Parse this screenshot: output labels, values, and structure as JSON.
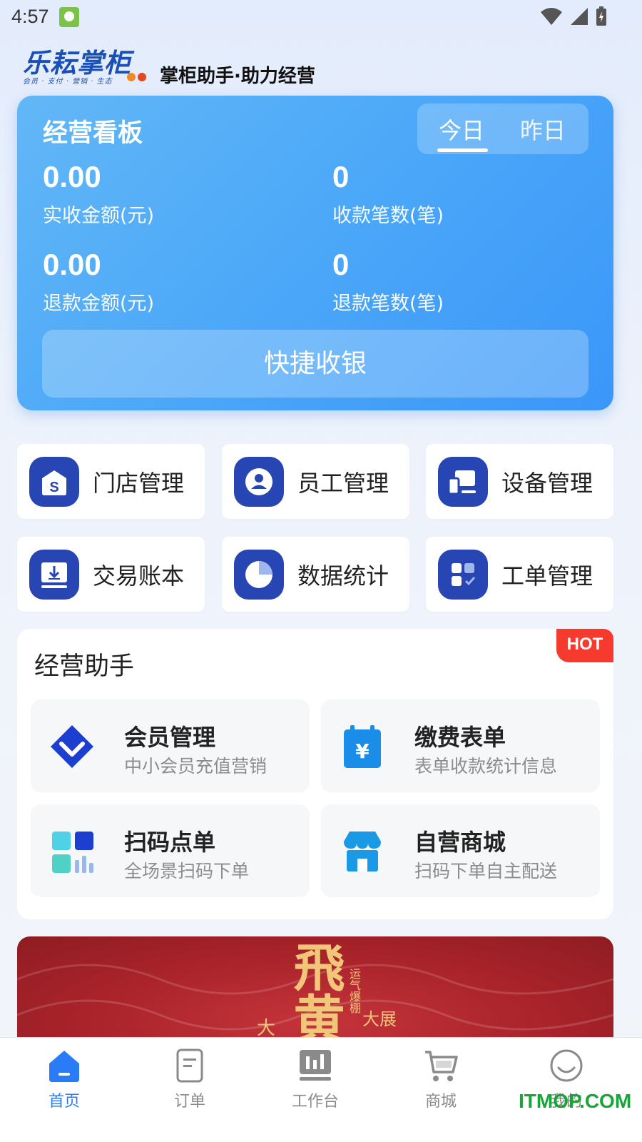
{
  "status_bar": {
    "time": "4:57",
    "icons": [
      "app-notification-icon",
      "wifi-icon",
      "signal-icon",
      "battery-charging-icon"
    ]
  },
  "brand": {
    "logo_text": "乐耘掌柜",
    "logo_subtext": "会员 · 支付 · 营销 · 生态",
    "slogan": "掌柜助手·助力经营"
  },
  "dashboard": {
    "title": "经营看板",
    "tabs": [
      {
        "label": "今日",
        "active": true
      },
      {
        "label": "昨日",
        "active": false
      }
    ],
    "metrics": [
      {
        "value": "0.00",
        "label": "实收金额(元)"
      },
      {
        "value": "0",
        "label": "收款笔数(笔)"
      },
      {
        "value": "0.00",
        "label": "退款金额(元)"
      },
      {
        "value": "0",
        "label": "退款笔数(笔)"
      }
    ],
    "quick_button": "快捷收银"
  },
  "grid": [
    {
      "label": "门店管理",
      "icon": "store-icon"
    },
    {
      "label": "员工管理",
      "icon": "employee-icon"
    },
    {
      "label": "设备管理",
      "icon": "device-icon"
    },
    {
      "label": "交易账本",
      "icon": "ledger-download-icon"
    },
    {
      "label": "数据统计",
      "icon": "pie-chart-icon"
    },
    {
      "label": "工单管理",
      "icon": "work-order-icon"
    }
  ],
  "assistant": {
    "title": "经营助手",
    "badge": "HOT",
    "items": [
      {
        "name": "会员管理",
        "desc": "中小会员充值营销",
        "icon": "diamond-icon"
      },
      {
        "name": "缴费表单",
        "desc": "表单收款统计信息",
        "icon": "yuan-calendar-icon"
      },
      {
        "name": "扫码点单",
        "desc": "全场景扫码下单",
        "icon": "scan-order-icon"
      },
      {
        "name": "自营商城",
        "desc": "扫码下单自主配送",
        "icon": "shop-icon"
      }
    ]
  },
  "banner": {
    "art_text": "飛黄",
    "side_text_left": "大",
    "side_text_right": "大展",
    "vertical_text": "运气爆棚"
  },
  "bottom_nav": [
    {
      "label": "首页",
      "icon": "home-icon",
      "active": true
    },
    {
      "label": "订单",
      "icon": "order-icon",
      "active": false
    },
    {
      "label": "工作台",
      "icon": "workbench-icon",
      "active": false
    },
    {
      "label": "商城",
      "icon": "cart-icon",
      "active": false
    },
    {
      "label": "我的",
      "icon": "profile-icon",
      "active": false
    }
  ],
  "watermark": "ITMOP.COM",
  "colors": {
    "accent": "#2a7cf6",
    "dashboard_blue": "#4ba7f8",
    "icon_navy": "#2746b4",
    "hot_red": "#f63a2e",
    "banner_red": "#a9232a"
  }
}
